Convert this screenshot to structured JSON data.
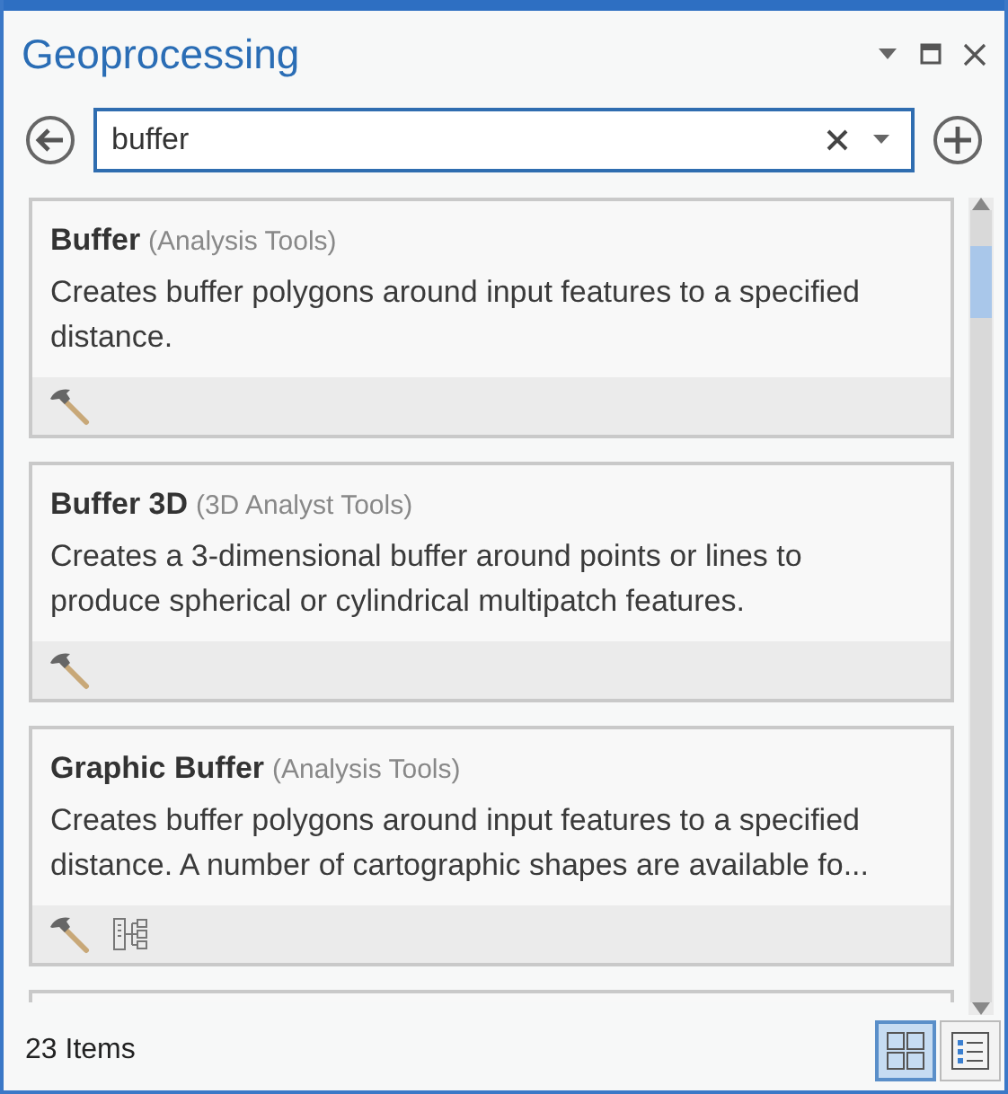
{
  "window": {
    "title": "Geoprocessing"
  },
  "search": {
    "value": "buffer"
  },
  "results": [
    {
      "name": "Buffer",
      "toolbox": "(Analysis Tools)",
      "description": "Creates buffer polygons around input features to a specified distance.",
      "icons": [
        {
          "kind": "tool"
        }
      ]
    },
    {
      "name": "Buffer 3D",
      "toolbox": "(3D Analyst Tools)",
      "description": "Creates a 3-dimensional buffer around points or lines to produce spherical or cylindrical multipatch features.",
      "icons": [
        {
          "kind": "tool"
        }
      ]
    },
    {
      "name": "Graphic Buffer",
      "toolbox": "(Analysis Tools)",
      "description": "Creates buffer polygons around input features to a specified distance. A number of cartographic shapes are available fo...",
      "icons": [
        {
          "kind": "tool"
        },
        {
          "kind": "model"
        }
      ]
    }
  ],
  "status_bar": {
    "count": "23 Items"
  },
  "views": [
    {
      "kind": "tiles",
      "selected": true
    },
    {
      "kind": "list",
      "selected": false
    }
  ]
}
